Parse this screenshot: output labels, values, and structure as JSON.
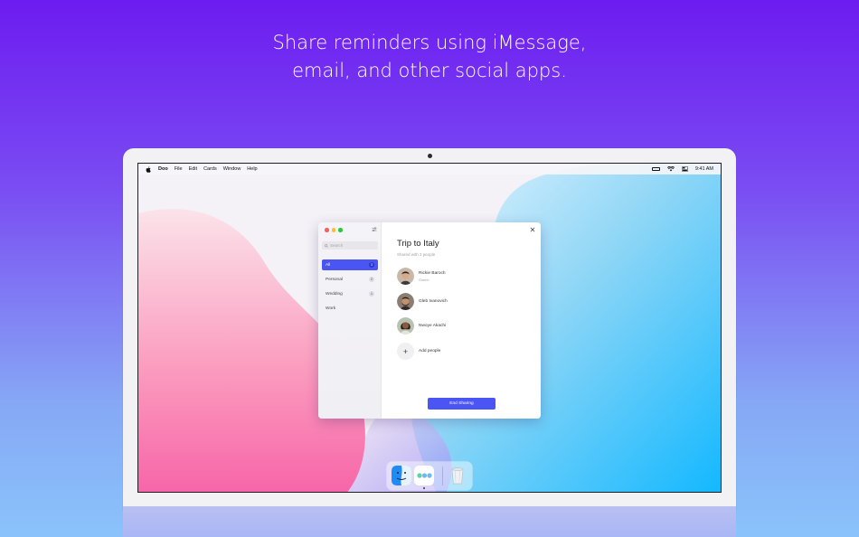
{
  "headline": {
    "line1": "Share reminders using iMessage,",
    "line2": "email, and other social apps."
  },
  "menubar": {
    "items": [
      "Doo",
      "File",
      "Edit",
      "Cards",
      "Window",
      "Help"
    ],
    "time": "9:41 AM"
  },
  "sidebar": {
    "search_placeholder": "Search",
    "items": [
      {
        "label": "All",
        "count": "3",
        "active": true
      },
      {
        "label": "Personal",
        "count": "2"
      },
      {
        "label": "Wedding",
        "count": "1"
      },
      {
        "label": "Work",
        "count": ""
      }
    ]
  },
  "detail": {
    "title": "Trip to Italy",
    "subtitle": "Shared with 2 people",
    "people": [
      {
        "name": "Rickie Baroch",
        "role": "Owner"
      },
      {
        "name": "Gleb Ivanovich",
        "role": ""
      },
      {
        "name": "Nwoye Akachi",
        "role": ""
      }
    ],
    "add_people_label": "Add people",
    "end_sharing_label": "End Sharing"
  },
  "colors": {
    "accent": "#4b55f3",
    "background_top": "#6d1cf0",
    "background_bottom": "#8ac3fb"
  },
  "icons": [
    "apple-icon",
    "battery-icon",
    "wifi-icon",
    "control-center-icon",
    "filter-icon",
    "search-icon",
    "close-icon",
    "plus-icon",
    "finder-icon",
    "doo-app-icon",
    "trash-icon"
  ]
}
